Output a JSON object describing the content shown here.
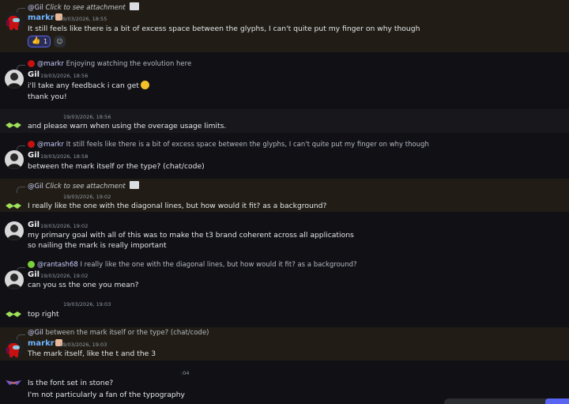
{
  "messages": [
    {
      "reply": {
        "author": "@Gil",
        "text": "Click to see attachment"
      },
      "author": "markr",
      "time": "19/03/2026, 18:55",
      "lines": [
        "It still feels like there is a bit of excess space between the glyphs, I can't quite put my finger on why though"
      ],
      "reaction": {
        "emoji": "👍",
        "count": "1"
      }
    },
    {
      "reply": {
        "author": "@markr",
        "text": "Enjoying watching the evolution here"
      },
      "author": "Gil",
      "time": "19/03/2026, 18:56",
      "lines": [
        "i'll take any feedback i can get",
        "thank you!"
      ]
    },
    {
      "time": "19/03/2026, 18:56",
      "lines": [
        "and please warn when using the overage usage limits."
      ]
    },
    {
      "reply": {
        "author": "@markr",
        "text": "It still feels like there is a bit of excess space between the glyphs, I can't quite put my finger on why though"
      },
      "author": "Gil",
      "time": "19/03/2026, 18:58",
      "lines": [
        "between the mark itself or the type? (chat/code)"
      ]
    },
    {
      "reply": {
        "author": "@Gil",
        "text": "Click to see attachment"
      },
      "time": "19/03/2026, 19:02",
      "lines": [
        "I really like the one with the diagonal lines, but how would it fit? as a background?"
      ]
    },
    {
      "author": "Gil",
      "time": "19/03/2026, 19:02",
      "lines": [
        "my primary goal with all of this was to make the t3 brand coherent across all applications",
        "so nailing the mark is really important"
      ]
    },
    {
      "reply": {
        "author": "@rantash68",
        "text": "I really like the one with the diagonal lines, but how would it fit? as a background?"
      },
      "author": "Gil",
      "time": "19/03/2026, 19:02",
      "lines": [
        "can you ss the one you mean?"
      ]
    },
    {
      "time": "19/03/2026, 19:03",
      "lines": [
        "top right"
      ]
    },
    {
      "reply": {
        "author": "@Gil",
        "text": "between the mark itself or the type? (chat/code)"
      },
      "author": "markr",
      "time": "19/03/2026, 19:03",
      "lines": [
        "The mark itself, like the t and the 3"
      ]
    },
    {
      "time": ":04",
      "lines": [
        "Is the font set in stone?",
        "I'm not particularly a fan of the typography"
      ]
    }
  ],
  "icons": {
    "reply_spine": "reply-spine-icon",
    "attachment": "image-icon",
    "add_reaction": "add-reaction-icon"
  },
  "colors": {
    "markr_name": "#6fb3ff",
    "mention_bg": "#211d16",
    "reaction_border": "#5865f2"
  }
}
